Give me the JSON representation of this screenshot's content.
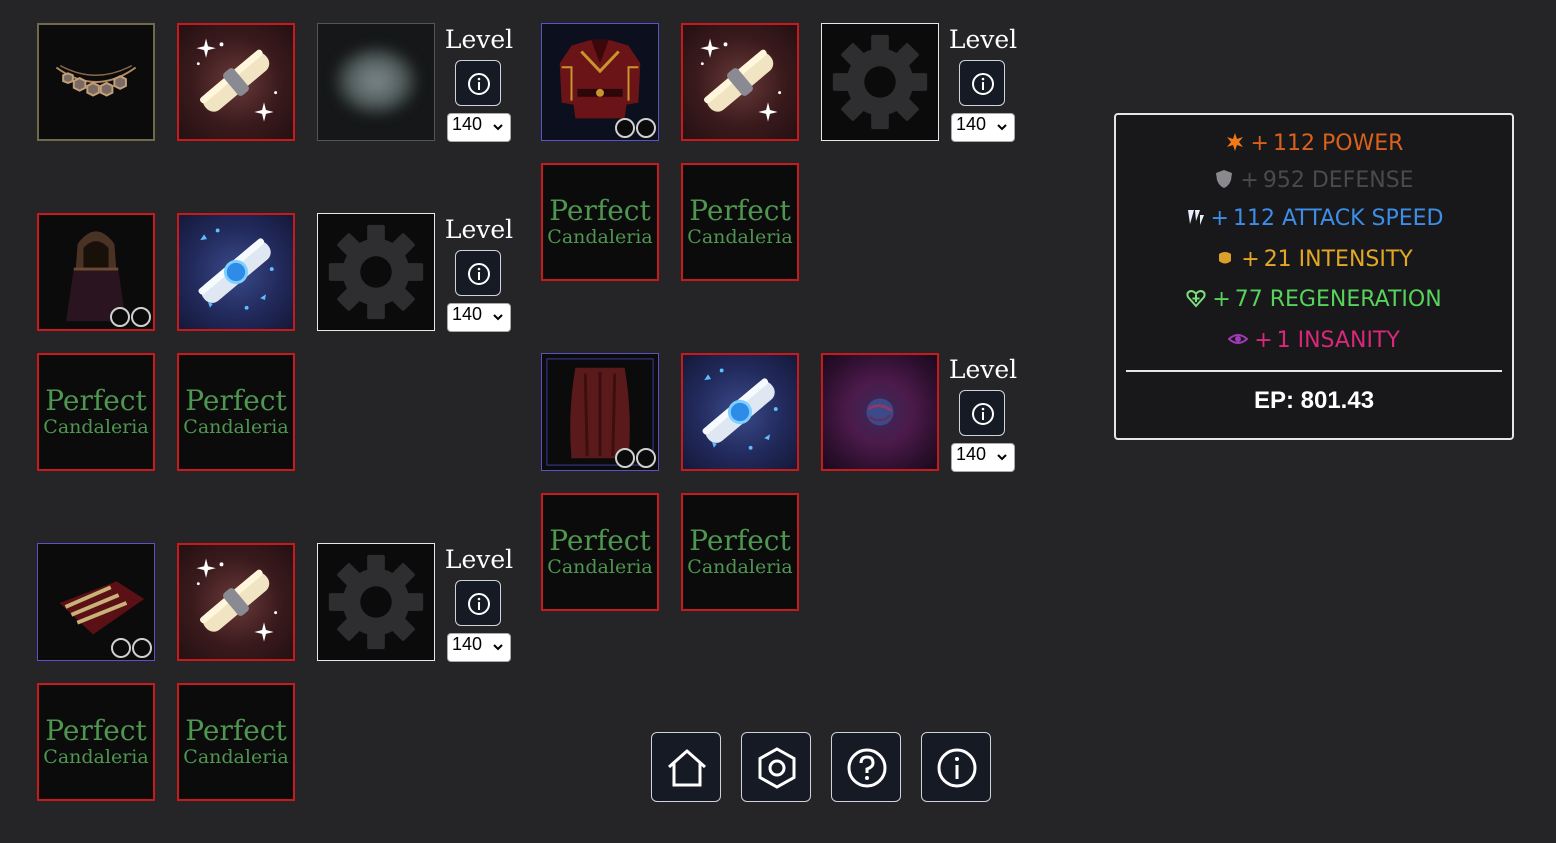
{
  "equipment_sets": [
    {
      "item": {
        "icon": "necklace-icon",
        "border_color": "#6f6a4c"
      },
      "scroll": {
        "icon": "scroll-sparkle-icon"
      },
      "augment": {
        "icon": "blurred-augment-icon"
      },
      "level": {
        "label": "Level",
        "value": "140"
      },
      "perfect_slots": []
    },
    {
      "item": {
        "icon": "chest-armor-icon",
        "border_color": "#5a53c8",
        "sockets": 2
      },
      "scroll": {
        "icon": "scroll-sparkle-icon"
      },
      "augment": {
        "icon": "gear-icon"
      },
      "level": {
        "label": "Level",
        "value": "140"
      },
      "perfect_slots": [
        {
          "line1": "Perfect",
          "line2": "Candaleria"
        },
        {
          "line1": "Perfect",
          "line2": "Candaleria"
        }
      ]
    },
    {
      "item": {
        "icon": "hood-icon",
        "border_color": "#c8191c",
        "sockets": 2
      },
      "scroll": {
        "icon": "scroll-blue-icon"
      },
      "augment": {
        "icon": "gear-icon"
      },
      "level": {
        "label": "Level",
        "value": "140"
      },
      "perfect_slots": [
        {
          "line1": "Perfect",
          "line2": "Candaleria"
        },
        {
          "line1": "Perfect",
          "line2": "Candaleria"
        }
      ]
    },
    {
      "item": {
        "icon": "cloak-icon",
        "border_color": "#5a53c8",
        "sockets": 2
      },
      "scroll": {
        "icon": "scroll-blue-icon"
      },
      "augment": {
        "icon": "orb-icon"
      },
      "level": {
        "label": "Level",
        "value": "140"
      },
      "perfect_slots": [
        {
          "line1": "Perfect",
          "line2": "Candaleria"
        },
        {
          "line1": "Perfect",
          "line2": "Candaleria"
        }
      ]
    },
    {
      "item": {
        "icon": "gloves-icon",
        "border_color": "#5a53c8",
        "sockets": 2
      },
      "scroll": {
        "icon": "scroll-sparkle-icon"
      },
      "augment": {
        "icon": "gear-icon"
      },
      "level": {
        "label": "Level",
        "value": "140"
      },
      "perfect_slots": [
        {
          "line1": "Perfect",
          "line2": "Candaleria"
        },
        {
          "line1": "Perfect",
          "line2": "Candaleria"
        }
      ]
    }
  ],
  "stats": [
    {
      "icon": "power-icon",
      "plus": "+",
      "text": "112 POWER",
      "color": "#d9611b"
    },
    {
      "icon": "defense-icon",
      "plus": "+",
      "text": "952 DEFENSE",
      "color": "#4a4a4e"
    },
    {
      "icon": "attack-speed-icon",
      "plus": "+",
      "text": "112 ATTACK SPEED",
      "color": "#3c8ee8"
    },
    {
      "icon": "intensity-icon",
      "plus": "+",
      "text": "21 INTENSITY",
      "color": "#e3a823"
    },
    {
      "icon": "regeneration-icon",
      "plus": "+",
      "text": "77 REGENERATION",
      "color": "#56d35a"
    },
    {
      "icon": "insanity-icon",
      "plus": "+",
      "text": "1 INSANITY",
      "color": "#d9287b"
    }
  ],
  "ep": {
    "label": "EP:",
    "value": "801.43",
    "text": "EP: 801.43"
  },
  "nav": [
    {
      "icon": "home-icon"
    },
    {
      "icon": "settings-hex-icon"
    },
    {
      "icon": "help-icon"
    },
    {
      "icon": "info-icon"
    }
  ]
}
